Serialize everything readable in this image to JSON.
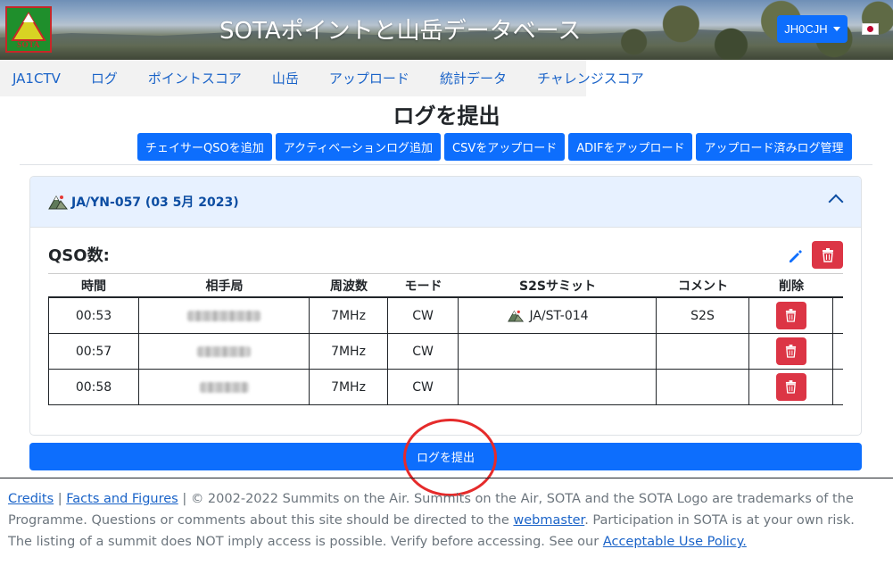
{
  "header": {
    "site_title": "SOTAポイントと山岳データベース",
    "logo_text": "SOTA",
    "user_button": "JH0CJH",
    "language_icon": "japan-flag-icon"
  },
  "nav": {
    "items": [
      "JA1CTV",
      "ログ",
      "ポイントスコア",
      "山岳",
      "アップロード",
      "統計データ",
      "チャレンジスコア"
    ]
  },
  "page": {
    "title": "ログを提出",
    "actions": [
      "チェイサーQSOを追加",
      "アクティベーションログ追加",
      "CSVをアップロード",
      "ADIFをアップロード",
      "アップロード済みログ管理"
    ]
  },
  "activation": {
    "title": "JA/YN-057 (03 5月 2023)",
    "qso_label": "QSO数:",
    "columns": [
      "時間",
      "相手局",
      "周波数",
      "モード",
      "S2Sサミット",
      "コメント",
      "削除"
    ],
    "rows": [
      {
        "time": "00:53",
        "freq": "7MHz",
        "mode": "CW",
        "s2s": "JA/ST-014",
        "comment": "S2S"
      },
      {
        "time": "00:57",
        "freq": "7MHz",
        "mode": "CW",
        "s2s": "",
        "comment": ""
      },
      {
        "time": "00:58",
        "freq": "7MHz",
        "mode": "CW",
        "s2s": "",
        "comment": ""
      }
    ]
  },
  "submit_label": "ログを提出",
  "footer": {
    "credits": "Credits",
    "sep1": " | ",
    "facts": "Facts and Figures",
    "text1": " | © 2002-2022 Summits on the Air. Summits on the Air, SOTA and the SOTA Logo are trademarks of the Programme. Questions or comments about this site should be directed to the ",
    "webmaster": "webmaster",
    "text2": ". Participation in SOTA is at your own risk. The listing of a summit does NOT imply access is possible. Verify before accessing. See our ",
    "aup": "Acceptable Use Policy.",
    "text3": ""
  },
  "colors": {
    "primary": "#0d6efd",
    "danger": "#dc3545",
    "link": "#1a63c8",
    "accordion_bg": "#e7f1ff",
    "annotation_circle": "#e52b2b"
  }
}
